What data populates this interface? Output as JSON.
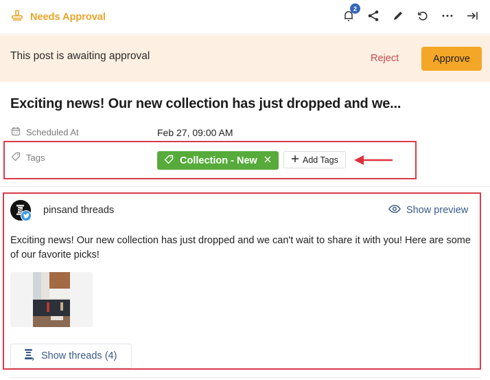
{
  "header": {
    "status_label": "Needs Approval",
    "notifications_count": "2",
    "toolbar_icons": [
      "bell-icon",
      "share-icon",
      "pencil-icon",
      "history-icon",
      "more-icon",
      "collapse-panel-icon"
    ]
  },
  "banner": {
    "message": "This post is awaiting approval",
    "reject_label": "Reject",
    "approve_label": "Approve"
  },
  "post": {
    "title": "Exciting news! Our new collection has just dropped and we...",
    "scheduled_label": "Scheduled At",
    "scheduled_value": "Feb 27, 09:00 AM",
    "tags_label": "Tags",
    "tags": [
      {
        "label": "Collection - New"
      }
    ],
    "add_tags_label": "Add Tags"
  },
  "preview": {
    "account_name": "pinsand threads",
    "network": "twitter",
    "show_preview_label": "Show preview",
    "body": "Exciting news! Our new collection has just dropped and we can't wait to share it with you! Here are some of our favorite picks!",
    "show_threads_label": "Show threads (4)"
  },
  "colors": {
    "status": "#e9a52a",
    "approve": "#f4a627",
    "reject": "#c4484e",
    "tag": "#56ab3a",
    "highlight": "#d83a4a",
    "link": "#3a5a8a",
    "badge": "#3566b8"
  }
}
